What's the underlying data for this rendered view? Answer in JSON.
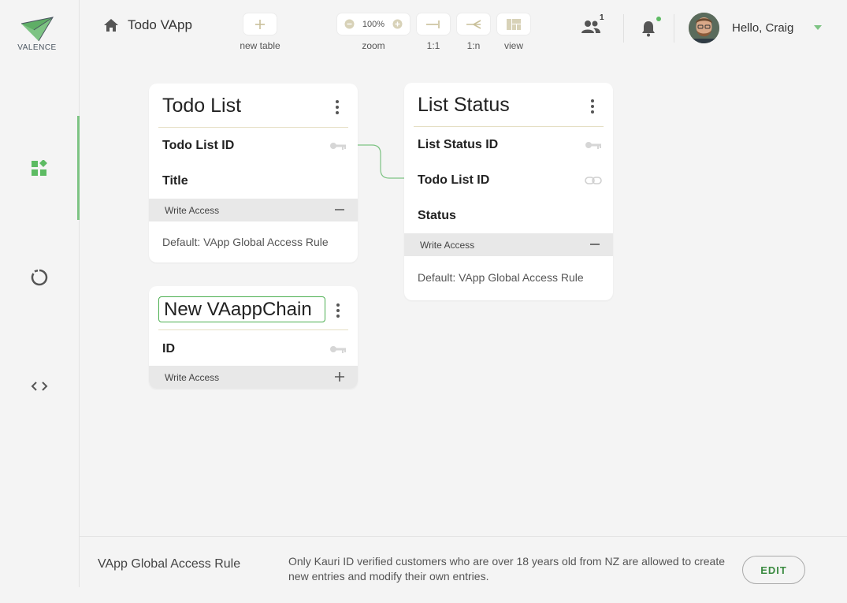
{
  "app": {
    "logo_text": "VALENCE",
    "breadcrumb_title": "Todo VApp"
  },
  "toolbar": {
    "new_table_label": "new table",
    "zoom_value": "100%",
    "zoom_label": "zoom",
    "one_to_one_label": "1:1",
    "one_to_many_label": "1:n",
    "view_label": "view"
  },
  "header": {
    "people_count": "1",
    "greeting": "Hello, Craig"
  },
  "tables": [
    {
      "title": "Todo List",
      "fields": [
        {
          "name": "Todo List ID",
          "icon": "key-icon"
        },
        {
          "name": "Title",
          "icon": ""
        }
      ],
      "access_label": "Write Access",
      "access_rule": "Default: VApp Global Access Rule"
    },
    {
      "title": "List Status",
      "fields": [
        {
          "name": "List Status ID",
          "icon": "key-icon"
        },
        {
          "name": "Todo List ID",
          "icon": "link-icon"
        },
        {
          "name": "Status",
          "icon": ""
        }
      ],
      "access_label": "Write Access",
      "access_rule": "Default: VApp Global Access Rule"
    },
    {
      "title_input_value": "New VAappChain",
      "fields": [
        {
          "name": "ID",
          "icon": "key-icon"
        }
      ],
      "access_label": "Write Access"
    }
  ],
  "footer": {
    "title": "VApp Global Access Rule",
    "description": "Only Kauri ID verified customers who are over 18 years old from NZ are allowed to create new entries and modify their own entries.",
    "edit_label": "EDIT"
  },
  "colors": {
    "accent": "#7dc383",
    "accent_dark": "#3a8a40"
  }
}
